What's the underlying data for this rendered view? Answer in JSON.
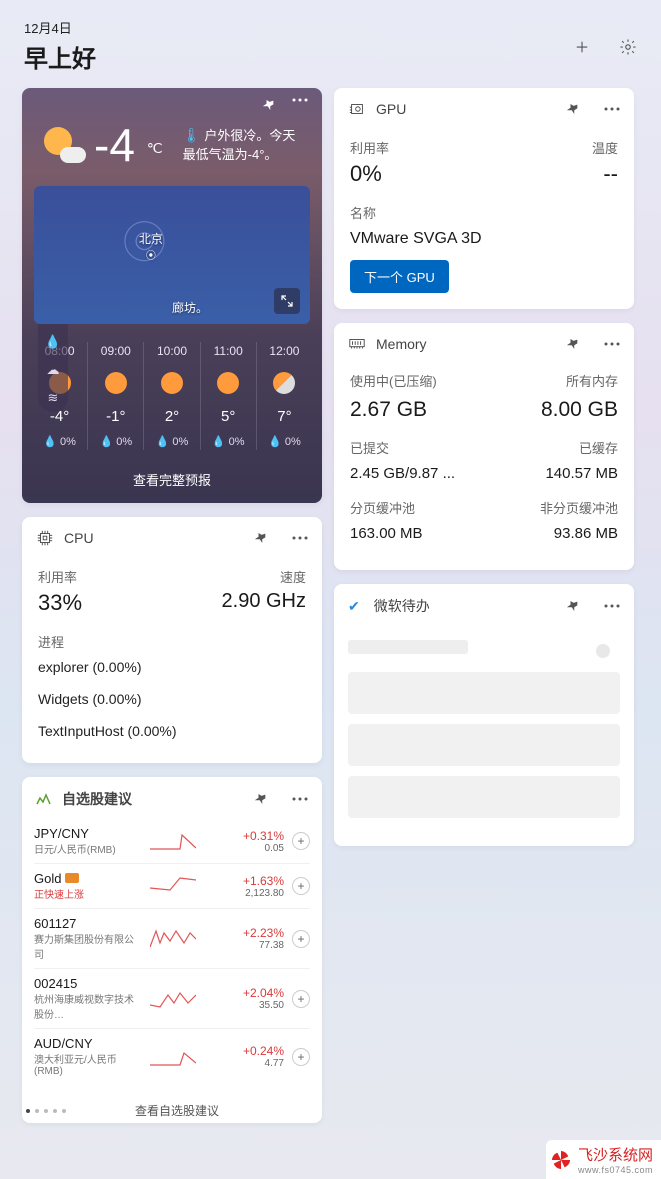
{
  "header": {
    "date": "12月4日",
    "greeting": "早上好"
  },
  "weather": {
    "temp": "-4",
    "unit": "℃",
    "desc": "户外很冷。今天最低气温为-4°。",
    "map": {
      "city1": "北京",
      "city2": "廊坊。"
    },
    "hours": [
      {
        "t": "08:00",
        "deg": "-4°",
        "rain": "0%"
      },
      {
        "t": "09:00",
        "deg": "-1°",
        "rain": "0%"
      },
      {
        "t": "10:00",
        "deg": "2°",
        "rain": "0%"
      },
      {
        "t": "11:00",
        "deg": "5°",
        "rain": "0%"
      },
      {
        "t": "12:00",
        "deg": "7°",
        "rain": "0%"
      }
    ],
    "footer": "查看完整预报"
  },
  "gpu": {
    "title": "GPU",
    "util_label": "利用率",
    "util_val": "0%",
    "temp_label": "温度",
    "temp_val": "--",
    "name_label": "名称",
    "name_val": "VMware SVGA 3D",
    "next_btn": "下一个 GPU"
  },
  "cpu": {
    "title": "CPU",
    "util_label": "利用率",
    "util_val": "33%",
    "speed_label": "速度",
    "speed_val": "2.90 GHz",
    "proc_label": "进程",
    "procs": [
      "explorer (0.00%)",
      "Widgets (0.00%)",
      "TextInputHost (0.00%)"
    ]
  },
  "memory": {
    "title": "Memory",
    "rows": [
      {
        "l": "使用中(已压缩)",
        "v": "2.67 GB",
        "r": "所有内存",
        "rv": "8.00 GB",
        "big": true
      },
      {
        "l": "已提交",
        "v": "2.45 GB/9.87 ...",
        "r": "已缓存",
        "rv": "140.57 MB"
      },
      {
        "l": "分页缓冲池",
        "v": "163.00 MB",
        "r": "非分页缓冲池",
        "rv": "93.86 MB"
      }
    ]
  },
  "todo": {
    "title": "微软待办"
  },
  "stocks": {
    "title": "自选股建议",
    "items": [
      {
        "sym": "JPY/CNY",
        "sub": "日元/人民币(RMB)",
        "chg": "+0.31%",
        "pr": "0.05"
      },
      {
        "sym": "Gold",
        "sub": "正快速上涨",
        "subred": true,
        "gold": true,
        "chg": "+1.63%",
        "pr": "2,123.80"
      },
      {
        "sym": "601127",
        "sub": "赛力斯集团股份有限公司",
        "chg": "+2.23%",
        "pr": "77.38"
      },
      {
        "sym": "002415",
        "sub": "杭州海康威视数字技术股份…",
        "chg": "+2.04%",
        "pr": "35.50"
      },
      {
        "sym": "AUD/CNY",
        "sub": "澳大利亚元/人民币(RMB)",
        "chg": "+0.24%",
        "pr": "4.77"
      }
    ],
    "footer": "查看自选股建议"
  },
  "watermark": {
    "name": "飞沙系统网",
    "url": "www.fs0745.com"
  }
}
